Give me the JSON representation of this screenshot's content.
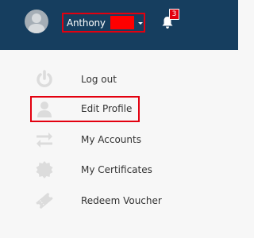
{
  "header": {
    "user_name": "Anthony",
    "notification_count": "3",
    "colors": {
      "bar": "#163e5f",
      "highlight": "#e3000f",
      "badge": "#e3000f",
      "redaction": "#ff0000"
    }
  },
  "menu": {
    "items": [
      {
        "label": "Log out",
        "icon": "power-icon"
      },
      {
        "label": "Edit Profile",
        "icon": "user-icon"
      },
      {
        "label": "My Accounts",
        "icon": "transfer-arrows-icon"
      },
      {
        "label": "My Certificates",
        "icon": "certificate-seal-icon"
      },
      {
        "label": "Redeem Voucher",
        "icon": "ticket-icon"
      }
    ]
  }
}
